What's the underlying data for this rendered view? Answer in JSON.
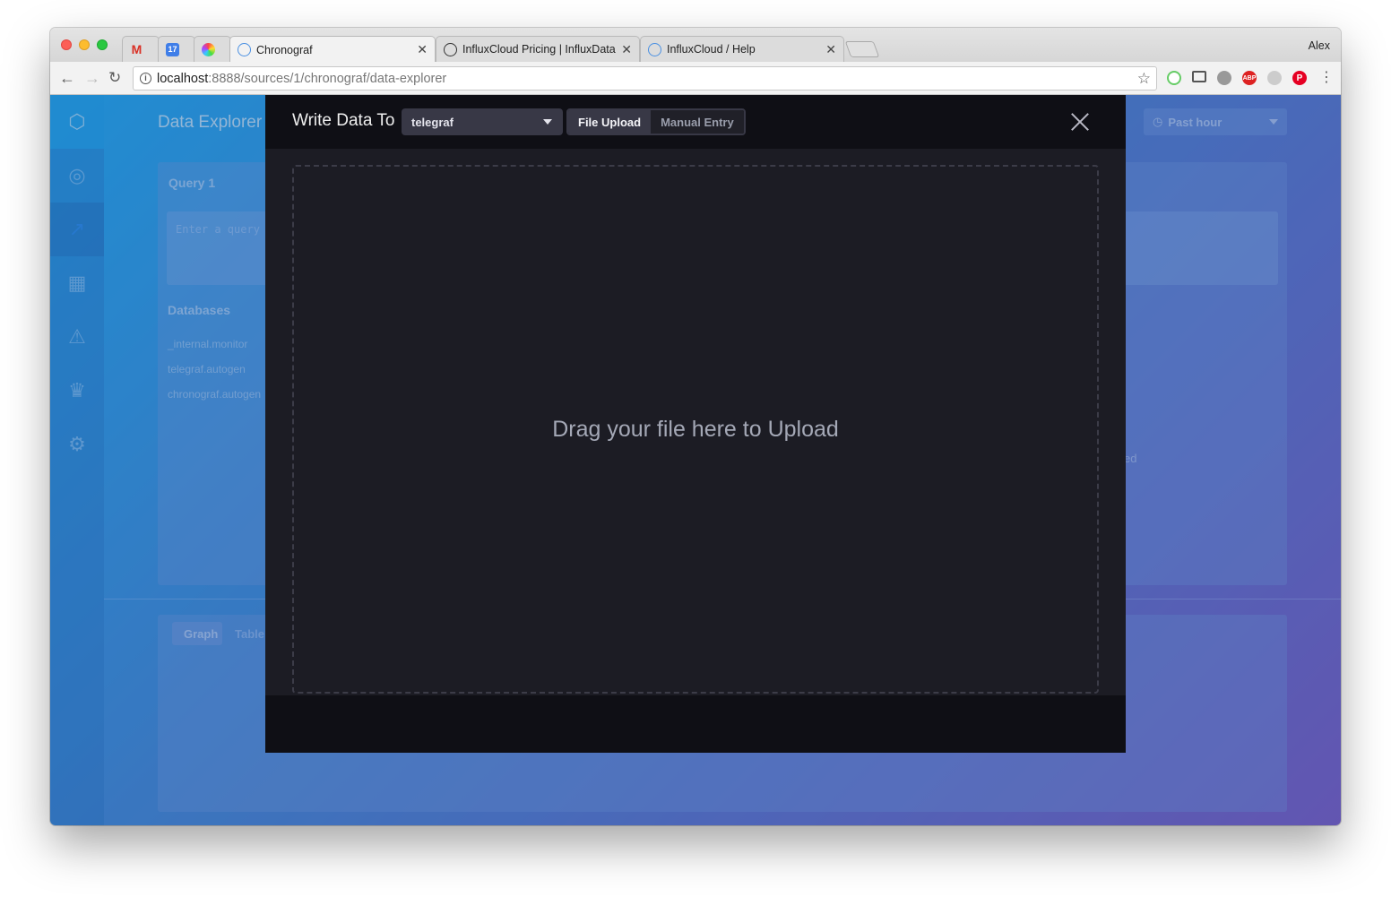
{
  "browser": {
    "tabs": [
      {
        "title": "",
        "favicon": "gmail-icon"
      },
      {
        "title": "",
        "favicon": "calendar-icon",
        "favicon_text": "17"
      },
      {
        "title": "",
        "favicon": "color-wheel-icon"
      },
      {
        "title": "Chronograf",
        "favicon": "chronograf-icon",
        "active": true
      },
      {
        "title": "InfluxCloud Pricing | InfluxData",
        "favicon": "influx-icon"
      },
      {
        "title": "InfluxCloud / Help",
        "favicon": "chronograf-icon"
      }
    ],
    "profile_name": "Alex",
    "url_host": "localhost",
    "url_rest": ":8888/sources/1/chronograf/data-explorer",
    "extensions": [
      "abp-icon",
      "pinterest-icon"
    ],
    "extension_labels": {
      "abp": "ABP",
      "pinterest": "P"
    }
  },
  "background": {
    "page_title": "Data Explorer",
    "query_tab": "Query 1",
    "query_placeholder": "Enter a query",
    "databases_heading": "Databases",
    "databases": [
      "_internal.monitor",
      "telegraf.autogen",
      "chronograf.autogen"
    ],
    "view_tabs": [
      "Graph",
      "Table"
    ],
    "time_range": "Past hour",
    "partial_text": "ed"
  },
  "modal": {
    "title": "Write Data To",
    "database": "telegraf",
    "mode_tabs": [
      "File Upload",
      "Manual Entry"
    ],
    "active_mode": "File Upload",
    "dropzone_text": "Drag your file here to Upload"
  },
  "colors": {
    "accent": "#22adf6",
    "modal_bg": "#0f0f15",
    "modal_body": "#1c1c24",
    "control_bg": "#383846"
  }
}
